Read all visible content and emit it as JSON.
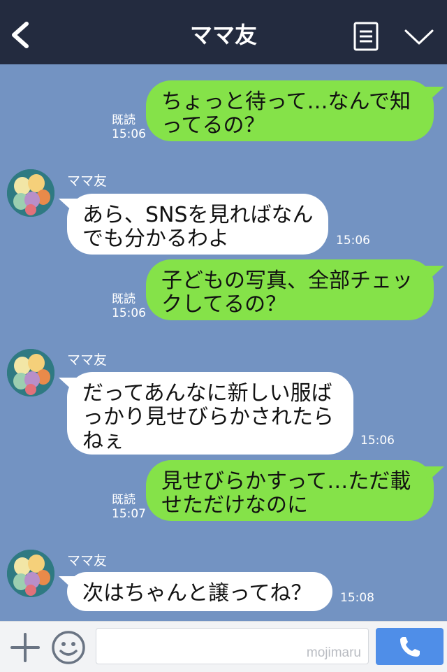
{
  "header": {
    "title": "ママ友",
    "back_icon": "chevron-left-icon",
    "menu_icon": "list-icon",
    "collapse_icon": "chevron-down-icon"
  },
  "messages": [
    {
      "from": "me",
      "lines": [
        "ちょっと待って…なんで知",
        "ってるの？"
      ],
      "read": "既読",
      "time": "15:06"
    },
    {
      "from": "them",
      "sender": "ママ友",
      "lines": [
        "あら、SNSを見ればなん",
        "でも分かるわよ"
      ],
      "time": "15:06"
    },
    {
      "from": "me",
      "lines": [
        "子どもの写真、全部チェッ",
        "クしてるの？"
      ],
      "read": "既読",
      "time": "15:06"
    },
    {
      "from": "them",
      "sender": "ママ友",
      "lines": [
        "だってあんなに新しい服ば",
        "っかり見せびらかされたら",
        "ねぇ"
      ],
      "time": "15:06"
    },
    {
      "from": "me",
      "lines": [
        "見せびらかすって…ただ載",
        "せただけなのに"
      ],
      "read": "既読",
      "time": "15:07"
    },
    {
      "from": "them",
      "sender": "ママ友",
      "lines": [
        "次はちゃんと譲ってね？"
      ],
      "time": "15:08"
    }
  ],
  "footer": {
    "plus_icon": "plus-icon",
    "sticker_icon": "smile-icon",
    "input_placeholder": "",
    "watermark": "mojimaru",
    "call_icon": "phone-icon"
  },
  "colors": {
    "background": "#7393c2",
    "header": "#232b3f",
    "my_bubble": "#85e249",
    "their_bubble": "#ffffff",
    "call_button": "#4f8ee8"
  }
}
